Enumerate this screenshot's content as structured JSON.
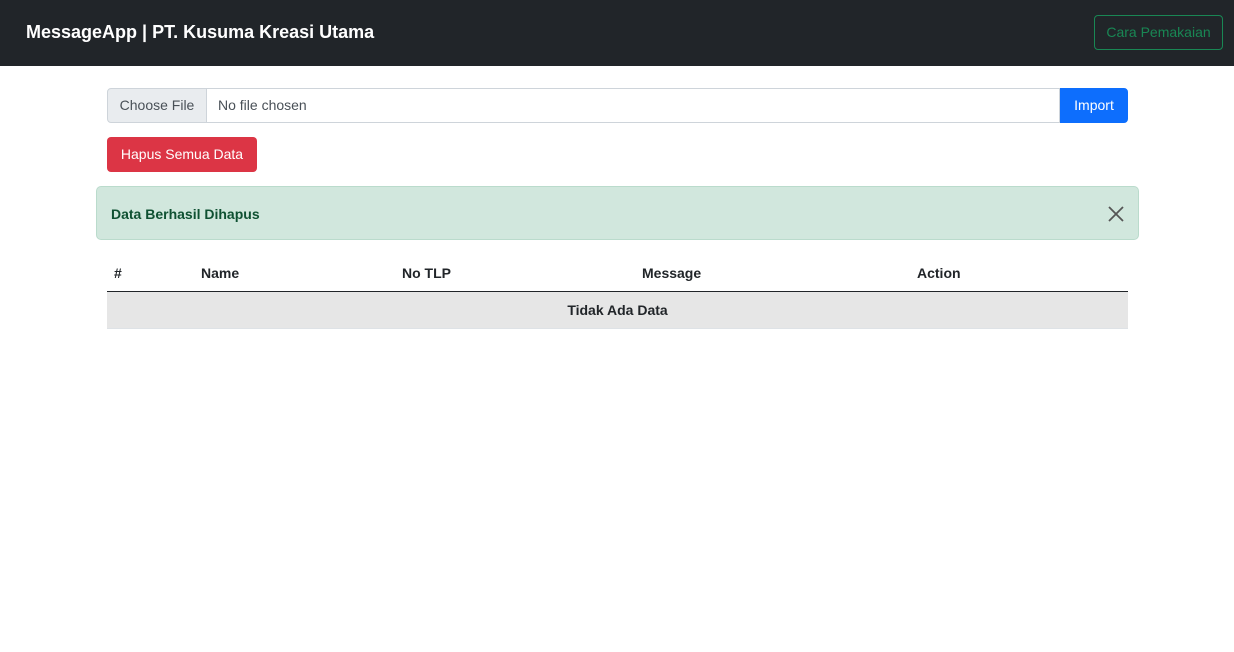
{
  "navbar": {
    "brand": "MessageApp | PT. Kusuma Kreasi Utama",
    "help_button": "Cara Pemakaian"
  },
  "upload": {
    "choose_label": "Choose File",
    "file_status": "No file chosen",
    "import_label": "Import"
  },
  "actions": {
    "delete_all_label": "Hapus Semua Data"
  },
  "alert": {
    "message": "Data Berhasil Dihapus",
    "close_icon": "close-icon"
  },
  "table": {
    "columns": [
      "#",
      "Name",
      "No TLP",
      "Message",
      "Action"
    ],
    "empty_message": "Tidak Ada Data"
  },
  "colors": {
    "navbar_bg": "#212529",
    "success": "#198754",
    "primary": "#0d6efd",
    "danger": "#dc3545",
    "alert_bg": "#d1e7dd"
  }
}
